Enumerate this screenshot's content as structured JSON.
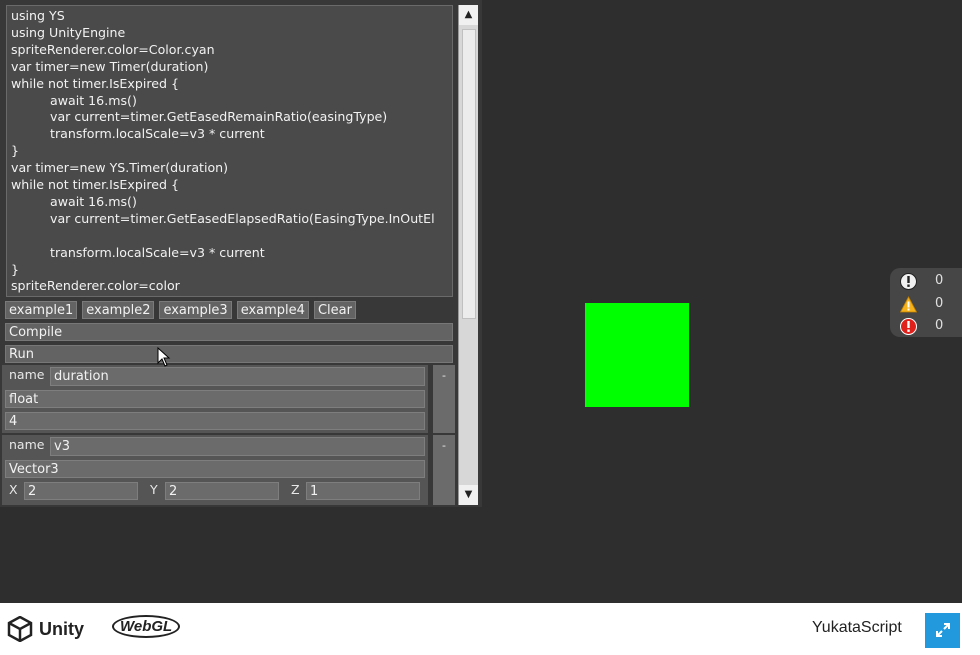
{
  "code": {
    "lines": [
      "using YS",
      "using UnityEngine",
      "spriteRenderer.color=Color.cyan",
      "var timer=new Timer(duration)",
      "while not timer.IsExpired {",
      "\tawait 16.ms()",
      "\tvar current=timer.GetEasedRemainRatio(easingType)",
      "\ttransform.localScale=v3 * current",
      "}",
      "var timer=new YS.Timer(duration)",
      "while not timer.IsExpired {",
      "\tawait 16.ms()",
      "\tvar current=timer.GetEasedElapsedRatio(EasingType.InOutEl",
      "",
      "\ttransform.localScale=v3 * current",
      "}",
      "spriteRenderer.color=color"
    ]
  },
  "buttons": {
    "example1": "example1",
    "example2": "example2",
    "example3": "example3",
    "example4": "example4",
    "clear": "Clear",
    "compile": "Compile",
    "run": "Run"
  },
  "params": [
    {
      "name_label": "name",
      "name": "duration",
      "type": "float",
      "value": "4",
      "remove": "-"
    },
    {
      "name_label": "name",
      "name": "v3",
      "type": "Vector3",
      "x_label": "X",
      "x": "2",
      "y_label": "Y",
      "y": "2",
      "z_label": "Z",
      "z": "1",
      "remove": "-"
    }
  ],
  "console": {
    "info_count": "0",
    "warning_count": "0",
    "error_count": "0"
  },
  "colors": {
    "sprite": "#00ff00",
    "background": "#2e2e2e",
    "accent": "#2299dd"
  },
  "footer": {
    "unity_label": "Unity",
    "webgl_label": "WebGL",
    "title": "YukataScript",
    "fullscreen_icon": "fullscreen-icon"
  }
}
